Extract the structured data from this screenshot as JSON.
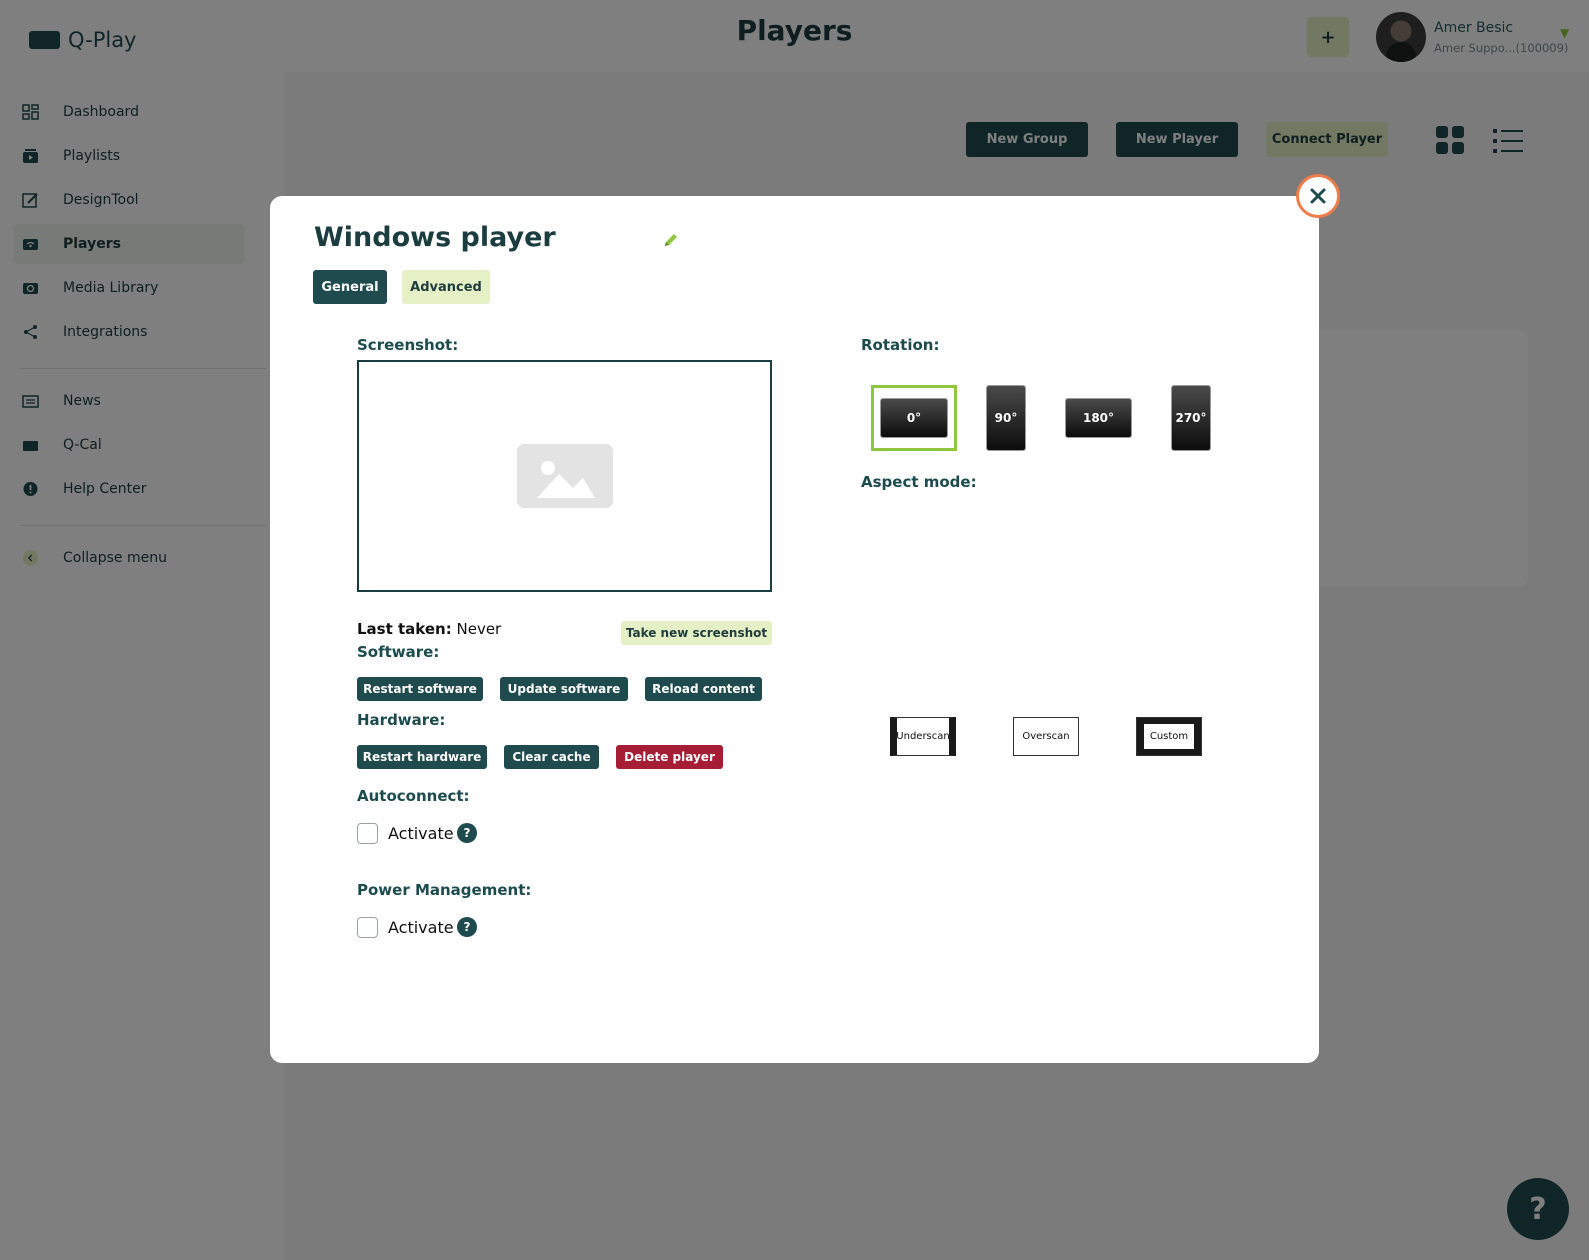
{
  "app": {
    "brand": "Q-Play",
    "page_title": "Players"
  },
  "header": {
    "add_label": "+",
    "user_name": "Amer Besic",
    "user_org": "Amer Suppo...(100009)"
  },
  "sidebar": {
    "items": [
      {
        "label": "Dashboard",
        "icon": "dashboard-icon"
      },
      {
        "label": "Playlists",
        "icon": "playlists-icon"
      },
      {
        "label": "DesignTool",
        "icon": "designtool-icon"
      },
      {
        "label": "Players",
        "icon": "players-icon",
        "active": true
      },
      {
        "label": "Media Library",
        "icon": "media-library-icon"
      },
      {
        "label": "Integrations",
        "icon": "integrations-icon"
      },
      {
        "label": "News",
        "icon": "news-icon"
      },
      {
        "label": "Q-Cal",
        "icon": "qcal-icon"
      },
      {
        "label": "Help Center",
        "icon": "help-center-icon"
      },
      {
        "label": "Collapse menu",
        "icon": "collapse-icon"
      }
    ]
  },
  "toolbar": {
    "new_group": "New Group",
    "new_player": "New Player",
    "connect_player": "Connect Player"
  },
  "modal": {
    "title": "Windows player",
    "tabs": {
      "general": "General",
      "advanced": "Advanced"
    },
    "screenshot_label": "Screenshot:",
    "last_taken_label": "Last taken:",
    "last_taken_value": "Never",
    "take_screenshot": "Take new screenshot",
    "software_label": "Software:",
    "software_buttons": {
      "restart": "Restart software",
      "update": "Update software",
      "reload": "Reload content"
    },
    "hardware_label": "Hardware:",
    "hardware_buttons": {
      "restart": "Restart hardware",
      "clear_cache": "Clear cache",
      "delete": "Delete player"
    },
    "autoconnect_label": "Autoconnect:",
    "autoconnect_activate": "Activate",
    "power_label": "Power Management:",
    "power_activate": "Activate",
    "help_glyph": "?",
    "rotation_label": "Rotation:",
    "rotations": [
      "0°",
      "90°",
      "180°",
      "270°"
    ],
    "aspect_label": "Aspect mode:",
    "aspects": [
      "Underscan",
      "Overscan",
      "Custom"
    ]
  },
  "help_fab": "?",
  "colors": {
    "primary": "#1f4b4f",
    "accent_light": "#e6f0c6",
    "danger": "#a61e35",
    "selection": "#8ec73f",
    "close_ring": "#f07c4c"
  }
}
